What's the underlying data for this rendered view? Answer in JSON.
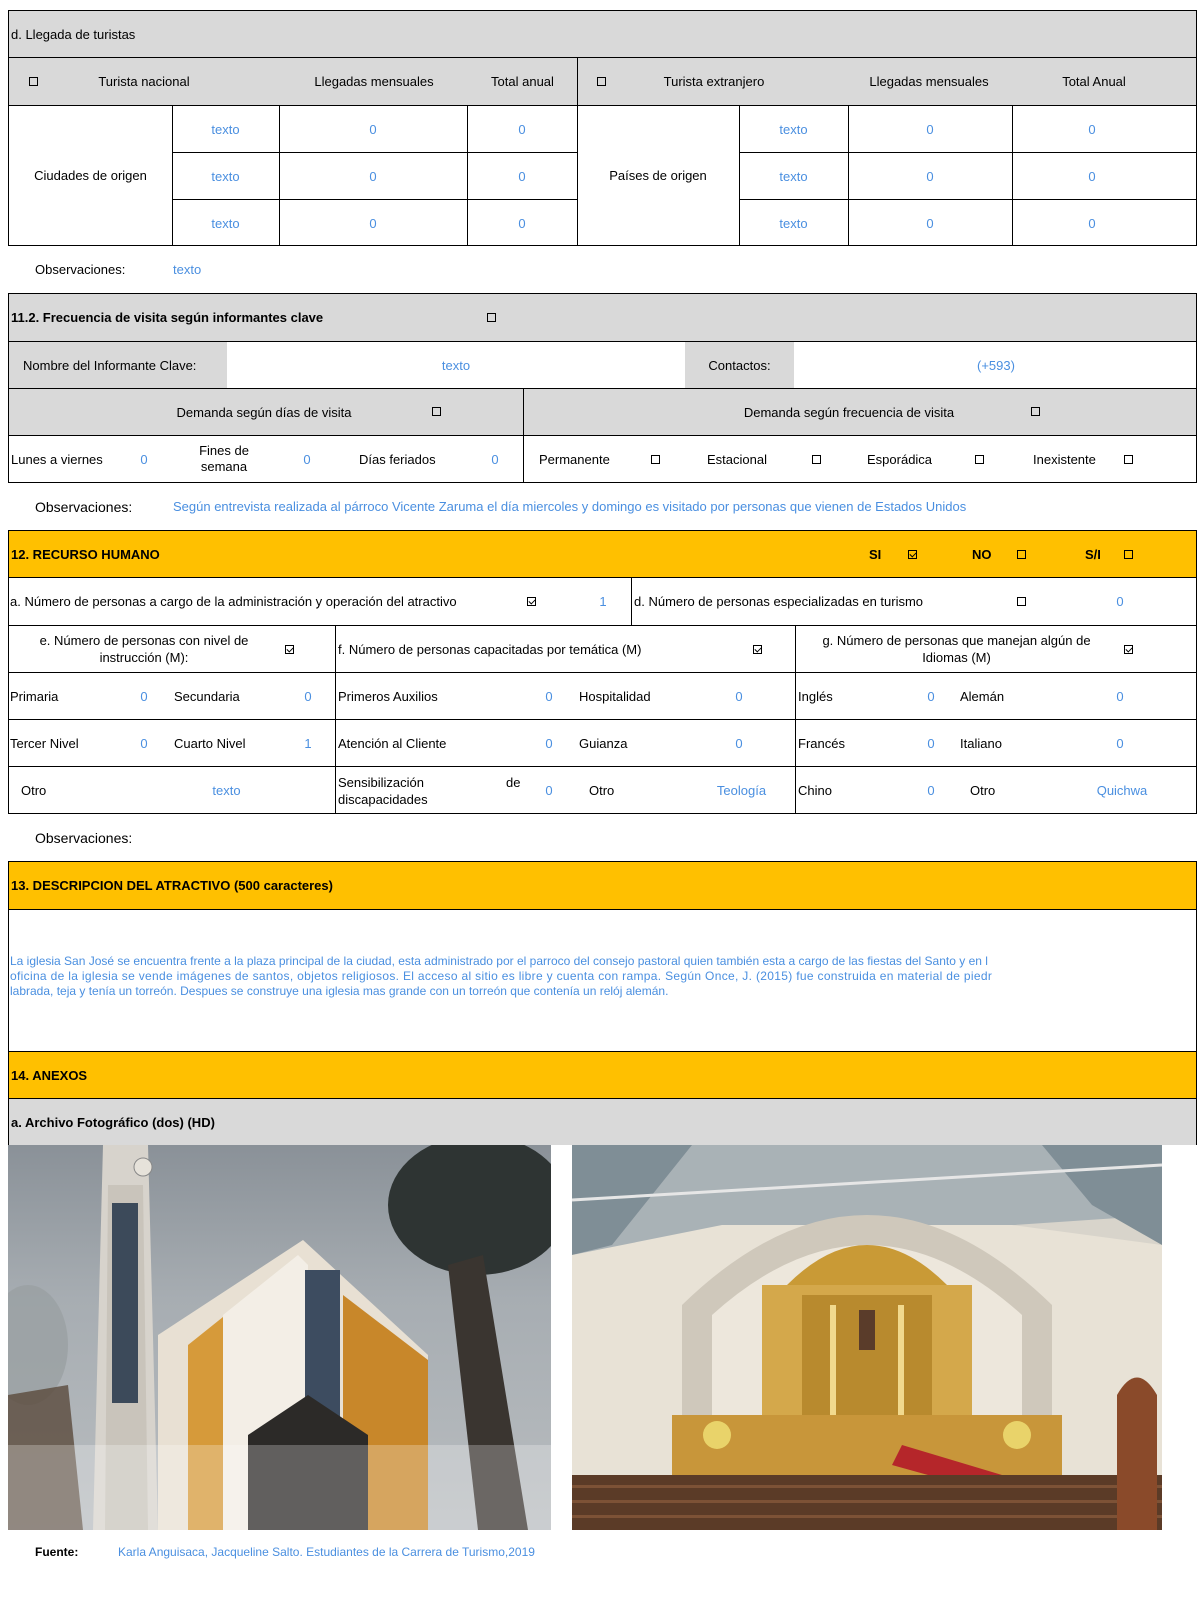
{
  "arrivals": {
    "title": "d. Llegada de turistas",
    "national": {
      "label": "Turista nacional",
      "monthly": "Llegadas mensuales",
      "annual": "Total anual",
      "origin_label": "Ciudades de origen",
      "rows": [
        {
          "name": "texto",
          "monthly": "0",
          "annual": "0"
        },
        {
          "name": "texto",
          "monthly": "0",
          "annual": "0"
        },
        {
          "name": "texto",
          "monthly": "0",
          "annual": "0"
        }
      ]
    },
    "foreign": {
      "label": "Turista extranjero",
      "monthly": "Llegadas mensuales",
      "annual": "Total Anual",
      "origin_label": "Países de origen",
      "rows": [
        {
          "name": "texto",
          "monthly": "0",
          "annual": "0"
        },
        {
          "name": "texto",
          "monthly": "0",
          "annual": "0"
        },
        {
          "name": "texto",
          "monthly": "0",
          "annual": "0"
        }
      ]
    },
    "obs_label": "Observaciones:",
    "obs_value": "texto"
  },
  "frequency": {
    "title": "11.2. Frecuencia de visita según informantes clave",
    "informant_label": "Nombre del Informante Clave:",
    "informant_value": "texto",
    "contacts_label": "Contactos:",
    "contacts_value": "(+593)",
    "days_header": "Demanda según  días de visita",
    "freq_header": "Demanda según frecuencia de visita",
    "weekdays_label": "Lunes a viernes",
    "weekdays_value": "0",
    "weekends_label_1": "Fines de",
    "weekends_label_2": "semana",
    "weekends_value": "0",
    "holidays_label": "Días feriados",
    "holidays_value": "0",
    "permanent": "Permanente",
    "seasonal": "Estacional",
    "sporadic": "Esporádica",
    "nonexistent": "Inexistente",
    "obs_label": "Observaciones:",
    "obs_value": "Según entrevista realizada al párroco Vicente Zaruma el día miercoles y domingo es visitado por personas que vienen de Estados Unidos"
  },
  "human": {
    "title": "12. RECURSO HUMANO",
    "si": "SI",
    "no": "NO",
    "si_no": "S/I",
    "admin_label": "a. Número de personas a cargo de la administración y operación del atractivo",
    "admin_value": "1",
    "specialized_label": "d. Número de personas especializadas en turismo",
    "specialized_value": "0",
    "education_label_1": "e. Número de personas con nivel de",
    "education_label_2": "instrucción (M):",
    "trained_label": "f. Número de personas capacitadas por temática (M)",
    "languages_label_1": "g. Número de personas que manejan algún de",
    "languages_label_2": "Idiomas (M)",
    "primaria": "Primaria",
    "primaria_v": "0",
    "secundaria": "Secundaria",
    "secundaria_v": "0",
    "tercer": "Tercer Nivel",
    "tercer_v": "0",
    "cuarto": "Cuarto Nivel",
    "cuarto_v": "1",
    "otro_edu": "Otro",
    "otro_edu_v": "texto",
    "auxilios": "Primeros Auxilios",
    "auxilios_v": "0",
    "hospitalidad": "Hospitalidad",
    "hospitalidad_v": "0",
    "atencion": "Atención al Cliente",
    "atencion_v": "0",
    "guianza": "Guianza",
    "guianza_v": "0",
    "sensib_1": "Sensibilización",
    "sensib_de": "de",
    "sensib_2": "discapacidades",
    "sensib_v": "0",
    "otro_tem": "Otro",
    "otro_tem_v": "Teología",
    "ingles": "Inglés",
    "ingles_v": "0",
    "aleman": "Alemán",
    "aleman_v": "0",
    "frances": "Francés",
    "frances_v": "0",
    "italiano": "Italiano",
    "italiano_v": "0",
    "chino": "Chino",
    "chino_v": "0",
    "otro_lang": "Otro",
    "otro_lang_v": "Quichwa",
    "obs_label": "Observaciones:"
  },
  "description": {
    "title": "13. DESCRIPCION DEL ATRACTIVO (500 caracteres)",
    "line1": "La iglesia San José se encuentra frente a la plaza principal de la ciudad, esta administrado por el parroco del consejo pastoral quien también esta a cargo de las fiestas del Santo y en l",
    "line2": "oficina de la iglesia se vende imágenes de santos, objetos religiosos. El acceso al sitio es libre y cuenta con rampa. Según Once, J. (2015)  fue construida en material de piedr",
    "line3": "labrada, teja y tenía un torreón. Despues se construye una iglesia mas grande con un torreón que contenía un relój alemán."
  },
  "annexes": {
    "title": "14. ANEXOS",
    "photo_title": "a. Archivo Fotográfico (dos) (HD)",
    "source_label": "Fuente:",
    "source_value": "Karla Anguisaca, Jacqueline Salto. Estudiantes de la Carrera de Turismo,2019"
  }
}
